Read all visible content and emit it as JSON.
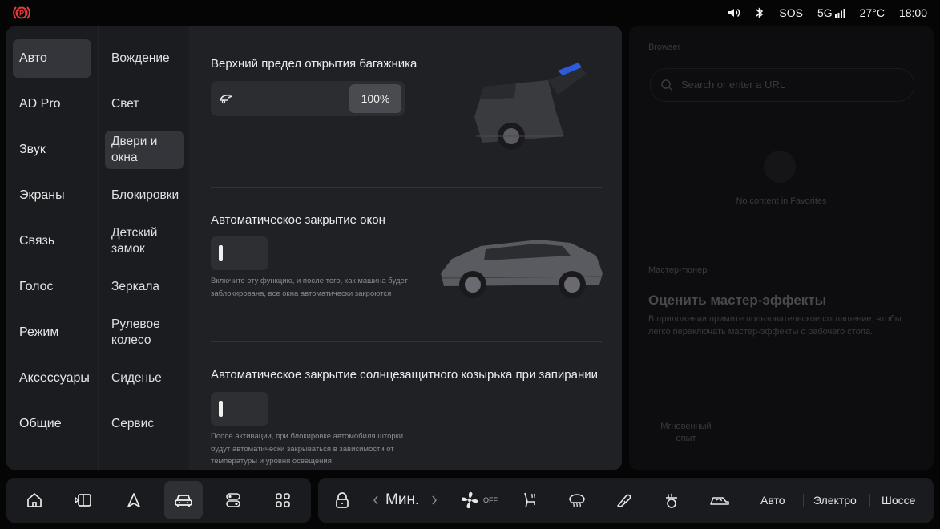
{
  "status_bar": {
    "sos": "SOS",
    "network": "5G",
    "temperature": "27°C",
    "time": "18:00",
    "icons": [
      "parking-brake-icon",
      "volume-icon",
      "bluetooth-icon",
      "signal-icon"
    ]
  },
  "nav": {
    "items": [
      {
        "label": "Авто",
        "active": true
      },
      {
        "label": "AD Pro"
      },
      {
        "label": "Звук"
      },
      {
        "label": "Экраны"
      },
      {
        "label": "Связь"
      },
      {
        "label": "Голос"
      },
      {
        "label": "Режим"
      },
      {
        "label": "Аксессуары"
      },
      {
        "label": "Общие"
      }
    ]
  },
  "subnav": {
    "items": [
      {
        "label": "Вождение"
      },
      {
        "label": "Свет"
      },
      {
        "label": "Двери и окна",
        "active": true
      },
      {
        "label": "Блокировки"
      },
      {
        "label": "Детский замок"
      },
      {
        "label": "Зеркала"
      },
      {
        "label": "Рулевое колесо"
      },
      {
        "label": "Сиденье"
      },
      {
        "label": "Сервис"
      }
    ]
  },
  "content": {
    "trunk": {
      "title": "Верхний предел открытия багажника",
      "value": "100%"
    },
    "windows": {
      "title": "Автоматическое закрытие окон",
      "description": "Включите эту функцию, и после того, как машина будет заблокирована, все окна автоматически закроются"
    },
    "sunshade": {
      "title": "Автоматическое закрытие солнцезащитного козырька при запирании",
      "description": "После активации, при блокировке автомобиля шторки будут автоматически закрываться в зависимости от температуры и уровня освещения"
    }
  },
  "background_panel": {
    "browser_label": "Browser",
    "search_placeholder": "Search or enter a URL",
    "no_content": "No content in Favorites",
    "tuner_label": "Мастер-тюнер",
    "tuner_title": "Оценить мастер-эффекты",
    "tuner_text": "В приложении примите пользовательское соглашение, чтобы легко переключать мастер-эффекты с рабочего стола.",
    "instant_label": "Мгновенный опыт"
  },
  "dock": {
    "fan_speed": "Мин.",
    "fan_state": "OFF",
    "modes": [
      "Авто",
      "Электро",
      "Шоссе"
    ]
  },
  "colors": {
    "panel_bg": "#1b1c1f",
    "content_bg": "#202124",
    "active_item": "#34353a",
    "accent_blue": "#2f5bd8"
  }
}
